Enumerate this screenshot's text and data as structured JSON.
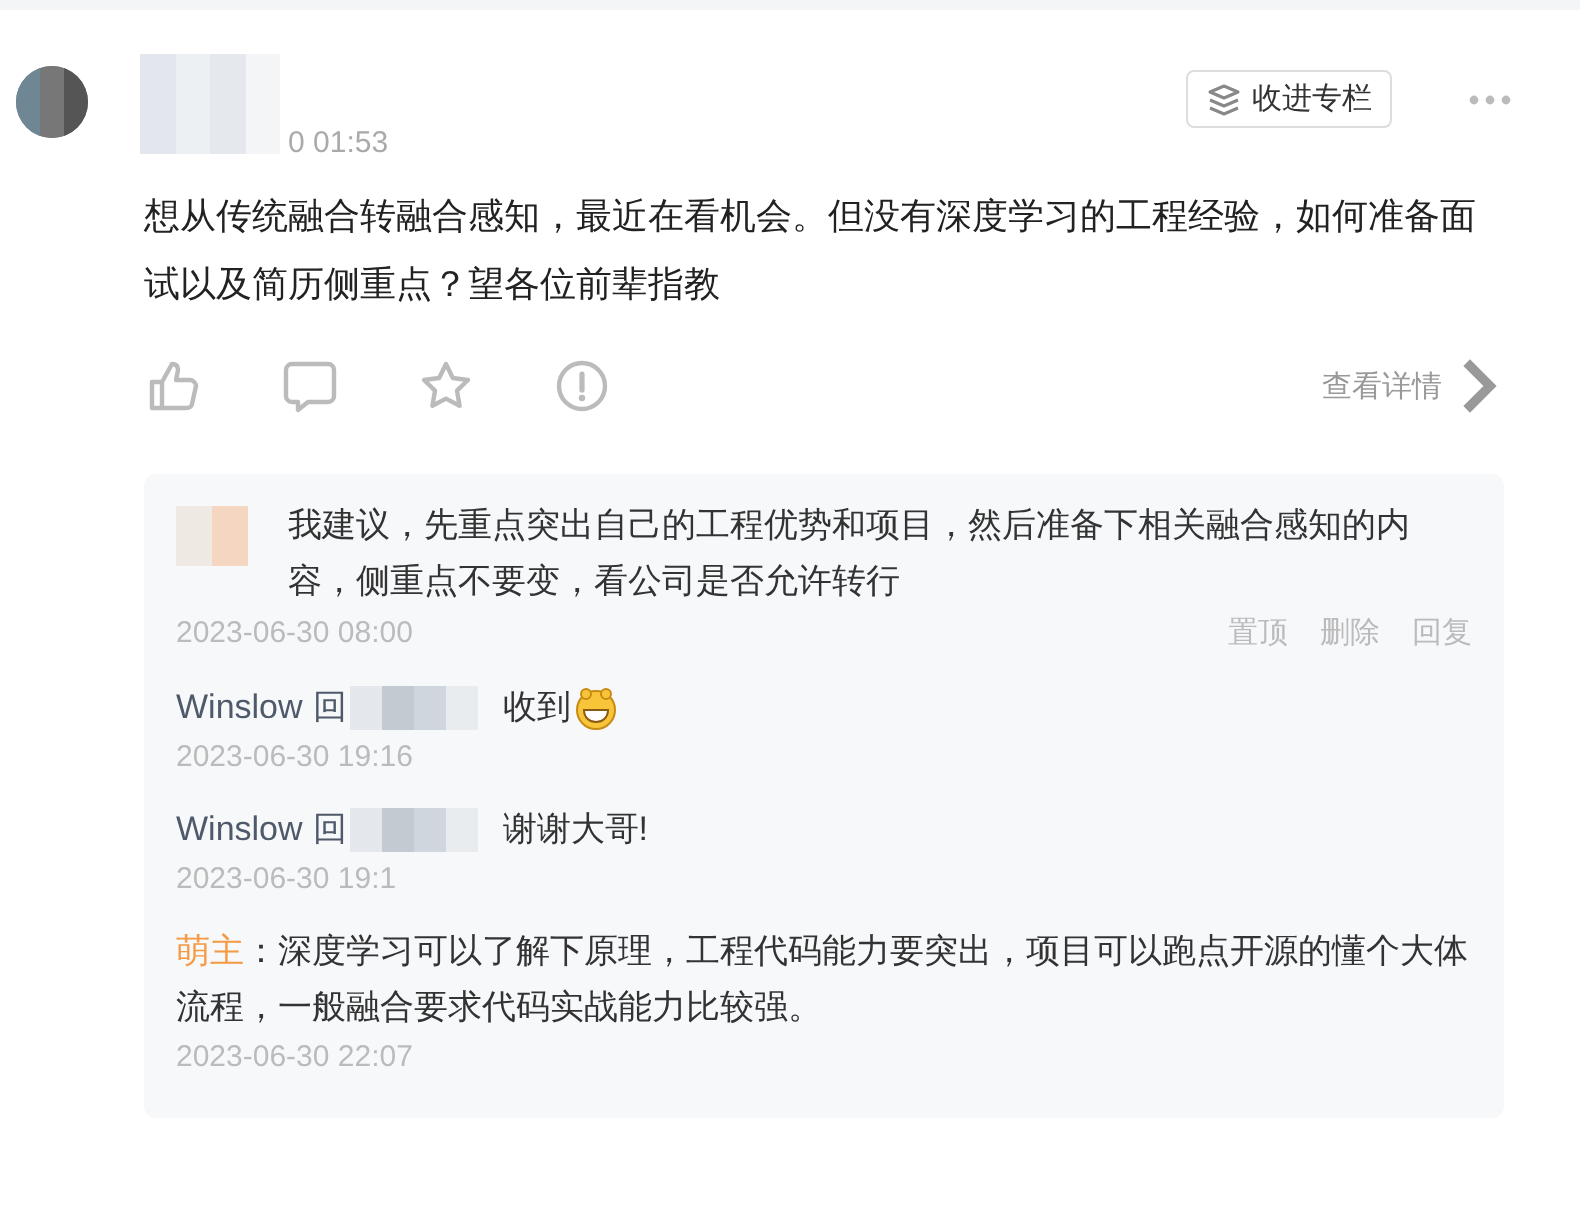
{
  "post": {
    "author": {
      "time": "0 01:53"
    },
    "collect_button": "收进专栏",
    "text": "想从传统融合转融合感知，最近在看机会。但没有深度学习的工程经验，如何准备面试以及简历侧重点？望各位前辈指教",
    "actions": [
      {
        "kind": "like"
      },
      {
        "kind": "comment"
      },
      {
        "kind": "favorite"
      },
      {
        "kind": "report"
      }
    ],
    "detail_link": "查看详情"
  },
  "replies": [
    {
      "kind": "comment",
      "text": "我建议，先重点突出自己的工程优势和项目，然后准备下相关融合感知的内容，侧重点不要变，看公司是否允许转行",
      "time": "2023-06-30 08:00",
      "actions": [
        "置顶",
        "删除",
        "回复"
      ]
    },
    {
      "kind": "reply",
      "author": "Winslow",
      "verb": "回",
      "text": "收到",
      "emoji": true,
      "time": "2023-06-30 19:16"
    },
    {
      "kind": "reply",
      "author": "Winslow",
      "verb": "回",
      "text": "谢谢大哥!",
      "emoji": false,
      "time": "2023-06-30 19:1"
    },
    {
      "kind": "owner_reply",
      "author": "萌主",
      "text": "：深度学习可以了解下原理，工程代码能力要突出，项目可以跑点开源的懂个大体流程，一般融合要求代码实战能力比较强。",
      "time": "2023-06-30 22:07"
    }
  ]
}
